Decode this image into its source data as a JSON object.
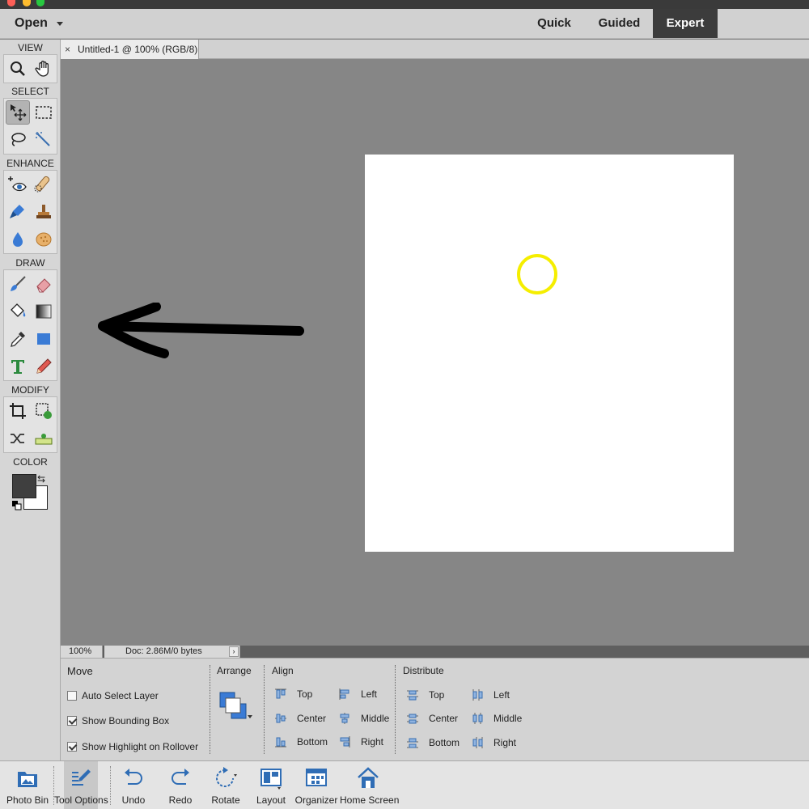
{
  "topbar": {
    "open_label": "Open",
    "modes": [
      {
        "label": "Quick",
        "active": false
      },
      {
        "label": "Guided",
        "active": false
      },
      {
        "label": "Expert",
        "active": true
      }
    ]
  },
  "toolbox": {
    "sections": {
      "view": "VIEW",
      "select": "SELECT",
      "enhance": "ENHANCE",
      "draw": "DRAW",
      "modify": "MODIFY",
      "color": "COLOR"
    },
    "tools": {
      "view": [
        "zoom-icon",
        "hand-icon"
      ],
      "select": [
        "move-icon",
        "marquee-icon",
        "lasso-icon",
        "magic-wand-icon"
      ],
      "enhance": [
        "red-eye-icon",
        "spot-healing-icon",
        "smart-brush-icon",
        "clone-stamp-icon",
        "blur-icon",
        "sponge-icon"
      ],
      "draw": [
        "brush-icon",
        "eraser-icon",
        "paint-bucket-icon",
        "gradient-icon",
        "eyedropper-icon",
        "shape-icon",
        "type-icon",
        "pencil-icon"
      ],
      "modify": [
        "crop-icon",
        "recompose-icon",
        "content-aware-move-icon",
        "straighten-icon"
      ]
    },
    "selected_tool": "move-icon",
    "colors": {
      "foreground": "#3f3f3f",
      "background": "#ffffff"
    }
  },
  "document": {
    "tab_close": "×",
    "tab_title": "Untitled-1 @ 100% (RGB/8)"
  },
  "annotation": {
    "circle_color": "#f5ee00",
    "arrow_color": "#000000"
  },
  "status": {
    "zoom": "100%",
    "doc_info": "Doc: 2.86M/0 bytes",
    "more": "›"
  },
  "options": {
    "move": {
      "title": "Move",
      "auto_select_layer": {
        "label": "Auto Select Layer",
        "checked": false
      },
      "show_bounding_box": {
        "label": "Show Bounding Box",
        "checked": true
      },
      "show_highlight": {
        "label": "Show Highlight on Rollover",
        "checked": true
      }
    },
    "arrange": {
      "title": "Arrange"
    },
    "align": {
      "title": "Align",
      "top": "Top",
      "center": "Center",
      "bottom": "Bottom",
      "left": "Left",
      "middle": "Middle",
      "right": "Right"
    },
    "distribute": {
      "title": "Distribute",
      "top": "Top",
      "center": "Center",
      "bottom": "Bottom",
      "left": "Left",
      "middle": "Middle",
      "right": "Right"
    }
  },
  "taskbar": {
    "photo_bin": "Photo Bin",
    "tool_options": "Tool Options",
    "undo": "Undo",
    "redo": "Redo",
    "rotate": "Rotate",
    "layout": "Layout",
    "organizer": "Organizer",
    "home_screen": "Home Screen"
  }
}
